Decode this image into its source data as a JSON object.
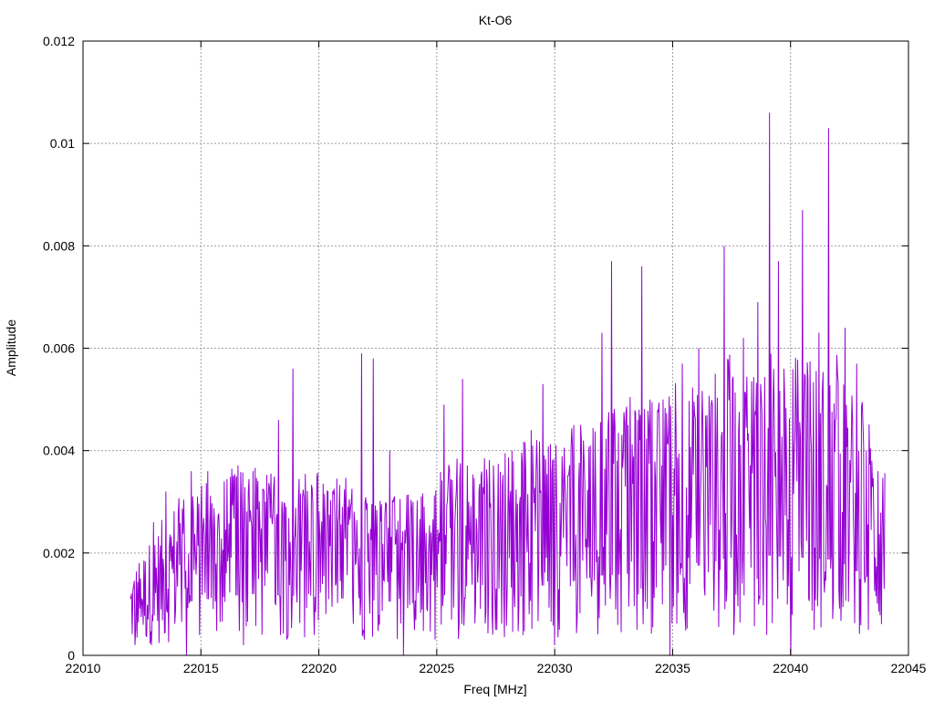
{
  "chart_data": {
    "type": "line",
    "title": "Kt-O6",
    "xlabel": "Freq [MHz]",
    "ylabel": "Amplitude",
    "xlim": [
      22010,
      22045
    ],
    "ylim": [
      0,
      0.012
    ],
    "x_ticks": [
      "22010",
      "22015",
      "22020",
      "22025",
      "22030",
      "22035",
      "22040",
      "22045"
    ],
    "y_ticks": [
      "0",
      "0.002",
      "0.004",
      "0.006",
      "0.008",
      "0.01",
      "0.012"
    ],
    "grid": true,
    "legend": "none",
    "series": [
      {
        "color": "#9400d3",
        "x_start": 22012.0,
        "x_end": 22044.0,
        "n_points": 1100,
        "baseline": [
          [
            22012.0,
            0.0009
          ],
          [
            22014.0,
            0.0017
          ],
          [
            22017.0,
            0.002
          ],
          [
            22020.0,
            0.0019
          ],
          [
            22024.0,
            0.0017
          ],
          [
            22026.0,
            0.0021
          ],
          [
            22030.0,
            0.0023
          ],
          [
            22032.0,
            0.0026
          ],
          [
            22034.0,
            0.0027
          ],
          [
            22036.0,
            0.0029
          ],
          [
            22038.0,
            0.0033
          ],
          [
            22040.0,
            0.0032
          ],
          [
            22042.0,
            0.0031
          ],
          [
            22044.0,
            0.0022
          ]
        ],
        "peaks": [
          [
            22013.0,
            0.0026
          ],
          [
            22013.5,
            0.0032
          ],
          [
            22014.6,
            0.0036
          ],
          [
            22015.3,
            0.0036
          ],
          [
            22016.0,
            0.0034
          ],
          [
            22016.5,
            0.0035
          ],
          [
            22017.2,
            0.0036
          ],
          [
            22018.3,
            0.0046
          ],
          [
            22018.9,
            0.0056
          ],
          [
            22019.8,
            0.0035
          ],
          [
            22021.0,
            0.0029
          ],
          [
            22021.8,
            0.0059
          ],
          [
            22022.3,
            0.0058
          ],
          [
            22023.0,
            0.004
          ],
          [
            22024.0,
            0.003
          ],
          [
            22025.3,
            0.0049
          ],
          [
            22026.1,
            0.0054
          ],
          [
            22027.5,
            0.004
          ],
          [
            22028.2,
            0.004
          ],
          [
            22029.0,
            0.0044
          ],
          [
            22029.5,
            0.0053
          ],
          [
            22030.8,
            0.0045
          ],
          [
            22031.5,
            0.0041
          ],
          [
            22032.0,
            0.0063
          ],
          [
            22032.4,
            0.0077
          ],
          [
            22033.1,
            0.0045
          ],
          [
            22033.7,
            0.0076
          ],
          [
            22034.6,
            0.005
          ],
          [
            22035.4,
            0.0057
          ],
          [
            22036.1,
            0.006
          ],
          [
            22036.8,
            0.0055
          ],
          [
            22037.2,
            0.008
          ],
          [
            22038.0,
            0.0062
          ],
          [
            22038.6,
            0.0069
          ],
          [
            22039.1,
            0.0106
          ],
          [
            22039.5,
            0.0077
          ],
          [
            22040.0,
            0.0072
          ],
          [
            22040.5,
            0.0087
          ],
          [
            22041.2,
            0.0063
          ],
          [
            22041.6,
            0.0103
          ],
          [
            22042.3,
            0.0064
          ],
          [
            22042.8,
            0.0057
          ],
          [
            22043.2,
            0.004
          ],
          [
            22043.7,
            0.0036
          ]
        ],
        "troughs": [
          [
            22012.2,
            0.0002
          ],
          [
            22014.4,
            0.0
          ],
          [
            22016.8,
            0.0002
          ],
          [
            22019.8,
            0.0004
          ],
          [
            22023.6,
            0.0
          ],
          [
            22025.2,
            0.0006
          ],
          [
            22027.5,
            0.0005
          ],
          [
            22030.0,
            0.0002
          ],
          [
            22034.9,
            0.0
          ],
          [
            22037.6,
            0.0004
          ],
          [
            22039.0,
            0.0004
          ],
          [
            22040.0,
            0.0
          ],
          [
            22041.0,
            0.0005
          ],
          [
            22043.3,
            0.0005
          ]
        ]
      }
    ]
  }
}
